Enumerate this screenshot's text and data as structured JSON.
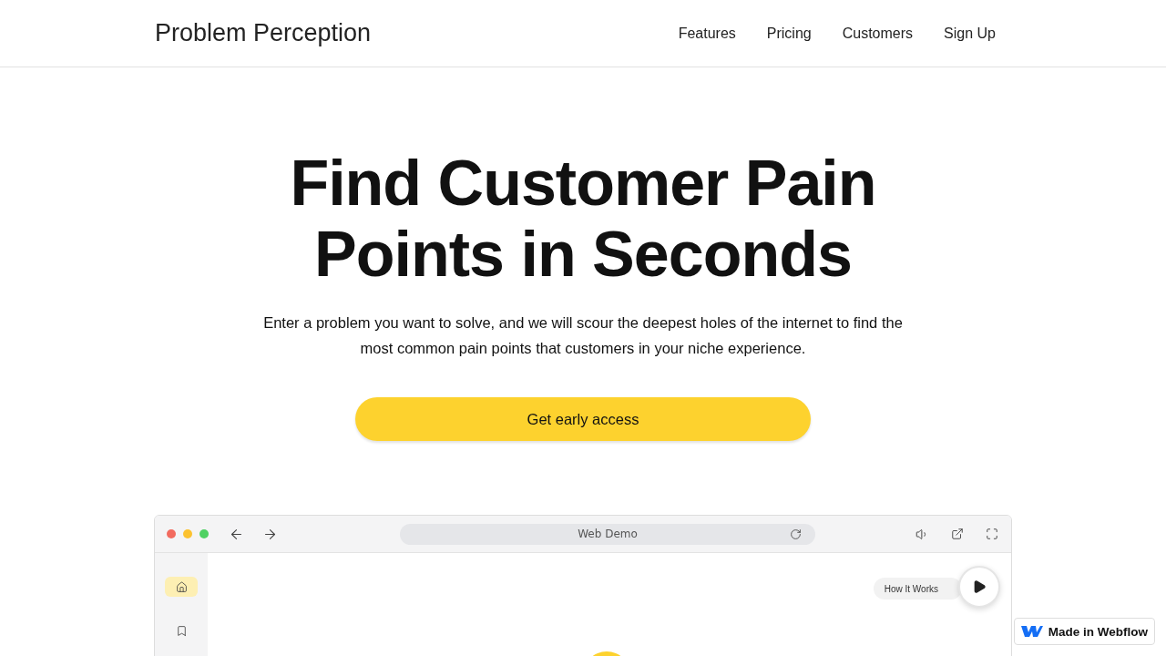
{
  "header": {
    "logo": "Problem Perception",
    "nav": [
      "Features",
      "Pricing",
      "Customers",
      "Sign Up"
    ]
  },
  "hero": {
    "title_lines": [
      "Find Customer Pain",
      "Points in Seconds"
    ],
    "subtitle": "Enter a problem you want to solve, and we will scour the deepest holes of the internet to find the most common pain points that customers in your niche experience.",
    "cta": "Get early access"
  },
  "demo_window": {
    "address": "Web Demo",
    "sidebar": [
      {
        "kind": "home",
        "selected": true
      },
      {
        "kind": "bookmark",
        "selected": false
      }
    ],
    "how_it_works": "How It Works"
  },
  "badge": {
    "label": "Made in Webflow"
  }
}
